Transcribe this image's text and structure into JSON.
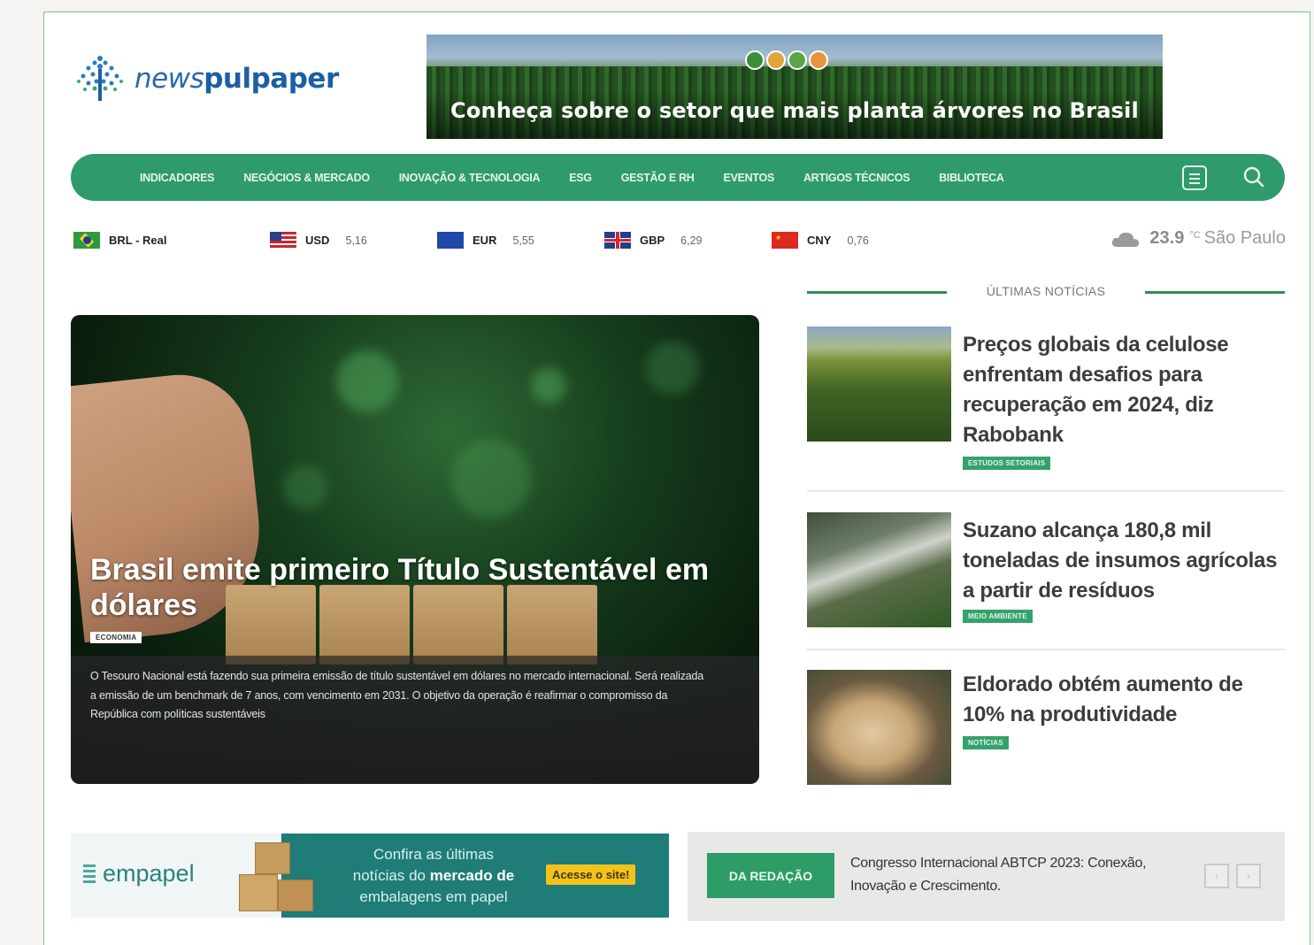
{
  "brand": {
    "name_light": "news",
    "name_bold": "pulpaper"
  },
  "top_banner": {
    "headline": "Conheça sobre o setor que mais planta árvores no Brasil"
  },
  "nav": {
    "items": [
      "INDICADORES",
      "NEGÓCIOS & MERCADO",
      "INOVAÇÃO & TECNOLOGIA",
      "ESG",
      "GESTÃO E RH",
      "EVENTOS",
      "ARTIGOS TÉCNICOS",
      "BIBLIOTECA"
    ],
    "menu_icon": "menu-icon",
    "search_icon": "search-icon"
  },
  "currencies": [
    {
      "code": "BRL - Real",
      "value": "",
      "flag": "brazil"
    },
    {
      "code": "USD",
      "value": "5,16",
      "flag": "usa"
    },
    {
      "code": "EUR",
      "value": "5,55",
      "flag": "eu"
    },
    {
      "code": "GBP",
      "value": "6,29",
      "flag": "uk"
    },
    {
      "code": "CNY",
      "value": "0,76",
      "flag": "china"
    }
  ],
  "weather": {
    "temp": "23.9",
    "unit": "°C",
    "city": "São Paulo",
    "icon": "cloud-icon"
  },
  "hero": {
    "title": "Brasil emite primeiro Título Sustentável em dólares",
    "tag": "ECONOMIA",
    "description": "O Tesouro Nacional está fazendo sua primeira emissão de título sustentável em dólares no mercado internacional. Será realizada a emissão de um benchmark de 7 anos, com vencimento em 2031. O objetivo da operação é reafirmar o compromisso da República com políticas sustentáveis"
  },
  "latest": {
    "header": "ÚLTIMAS NOTÍCIAS",
    "items": [
      {
        "title": "Preços globais da celulose enfrentam desafios para recuperação em 2024, diz Rabobank",
        "tag": "ESTUDOS SETORIAIS"
      },
      {
        "title": "Suzano alcança 180,8 mil toneladas de insumos agrícolas a partir de resíduos",
        "tag": "MEIO AMBIENTE"
      },
      {
        "title": "Eldorado obtém aumento de 10% na produtividade",
        "tag": "NOTÍCIAS"
      }
    ]
  },
  "empapel": {
    "logo": "empapel",
    "text_1": "Confira as últimas",
    "text_2a": "notícias do ",
    "text_2b": "mercado de",
    "text_3": "embalagens em papel",
    "cta": "Acesse o site!"
  },
  "ticker": {
    "label": "DA REDAÇÃO",
    "text": "Congresso Internacional ABTCP 2023: Conexão, Inovação e Crescimento.",
    "prev": "‹",
    "next": "›"
  },
  "colors": {
    "brand_green": "#2f9a6b",
    "logo_blue": "#1d5ea3",
    "cta_yellow": "#f4c21b"
  }
}
